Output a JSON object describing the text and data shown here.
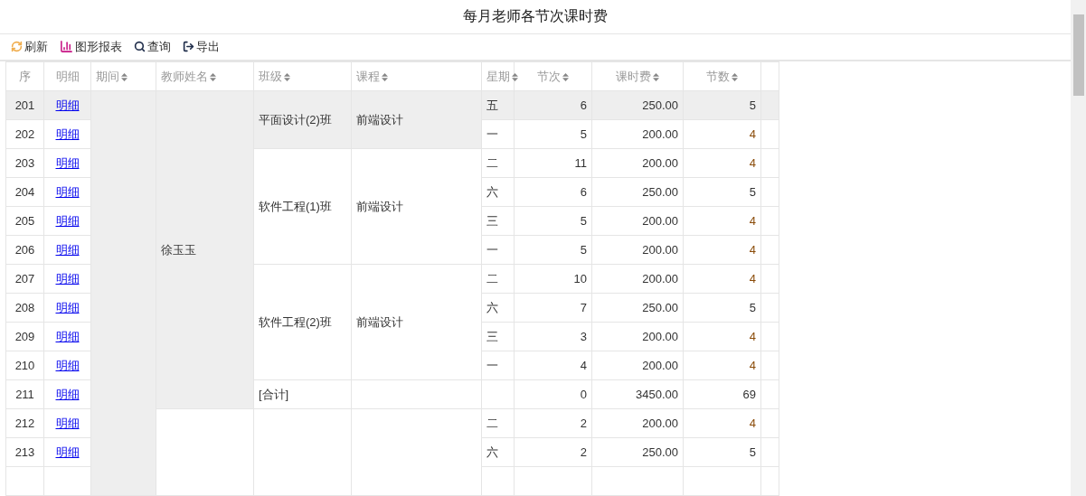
{
  "title": "每月老师各节次课时费",
  "toolbar": [
    {
      "kind": "refresh",
      "label": "刷新"
    },
    {
      "kind": "chart",
      "label": "图形报表"
    },
    {
      "kind": "search",
      "label": "查询"
    },
    {
      "kind": "export",
      "label": "导出"
    }
  ],
  "columns": [
    {
      "label": "序",
      "sortable": false
    },
    {
      "label": "明细",
      "sortable": false
    },
    {
      "label": "期间",
      "sortable": true
    },
    {
      "label": "教师姓名",
      "sortable": true
    },
    {
      "label": "班级",
      "sortable": true
    },
    {
      "label": "课程",
      "sortable": true
    },
    {
      "label": "星期",
      "sortable": true
    },
    {
      "label": "节次",
      "sortable": true
    },
    {
      "label": "课时费",
      "sortable": true
    },
    {
      "label": "节数",
      "sortable": true
    }
  ],
  "teachers": [
    {
      "name": "徐玉玉",
      "classes": [
        {
          "class": "平面设计(2)班",
          "course": "前端设计",
          "rows": [
            {
              "seq": "201",
              "detail": "明细",
              "weekday": "五",
              "periods": "6",
              "fee": "250.00",
              "count": "5",
              "count_flagged": false,
              "highlighted": true
            },
            {
              "seq": "202",
              "detail": "明细",
              "weekday": "一",
              "periods": "5",
              "fee": "200.00",
              "count": "4",
              "count_flagged": true,
              "highlighted": false
            }
          ]
        },
        {
          "class": "软件工程(1)班",
          "course": "前端设计",
          "rows": [
            {
              "seq": "203",
              "detail": "明细",
              "weekday": "二",
              "periods": "11",
              "fee": "200.00",
              "count": "4",
              "count_flagged": true,
              "highlighted": false
            },
            {
              "seq": "204",
              "detail": "明细",
              "weekday": "六",
              "periods": "6",
              "fee": "250.00",
              "count": "5",
              "count_flagged": false,
              "highlighted": false
            },
            {
              "seq": "205",
              "detail": "明细",
              "weekday": "三",
              "periods": "5",
              "fee": "200.00",
              "count": "4",
              "count_flagged": true,
              "highlighted": false
            },
            {
              "seq": "206",
              "detail": "明细",
              "weekday": "一",
              "periods": "5",
              "fee": "200.00",
              "count": "4",
              "count_flagged": true,
              "highlighted": false
            }
          ]
        },
        {
          "class": "软件工程(2)班",
          "course": "前端设计",
          "rows": [
            {
              "seq": "207",
              "detail": "明细",
              "weekday": "二",
              "periods": "10",
              "fee": "200.00",
              "count": "4",
              "count_flagged": true,
              "highlighted": false
            },
            {
              "seq": "208",
              "detail": "明细",
              "weekday": "六",
              "periods": "7",
              "fee": "250.00",
              "count": "5",
              "count_flagged": false,
              "highlighted": false
            },
            {
              "seq": "209",
              "detail": "明细",
              "weekday": "三",
              "periods": "3",
              "fee": "200.00",
              "count": "4",
              "count_flagged": true,
              "highlighted": false
            },
            {
              "seq": "210",
              "detail": "明细",
              "weekday": "一",
              "periods": "4",
              "fee": "200.00",
              "count": "4",
              "count_flagged": true,
              "highlighted": false
            }
          ]
        },
        {
          "class": "[合计]",
          "rows": [
            {
              "seq": "211",
              "detail": "明细",
              "periods": "0",
              "fee": "3450.00",
              "count": "69",
              "count_flagged": false,
              "highlighted": false
            }
          ]
        }
      ]
    },
    {
      "classes": [
        {
          "rows": [
            {
              "seq": "212",
              "detail": "明细",
              "weekday": "二",
              "periods": "2",
              "fee": "200.00",
              "count": "4",
              "count_flagged": true,
              "highlighted": false
            },
            {
              "seq": "213",
              "detail": "明细",
              "weekday": "六",
              "periods": "2",
              "fee": "250.00",
              "count": "5",
              "count_flagged": false,
              "highlighted": false
            }
          ]
        }
      ]
    }
  ]
}
